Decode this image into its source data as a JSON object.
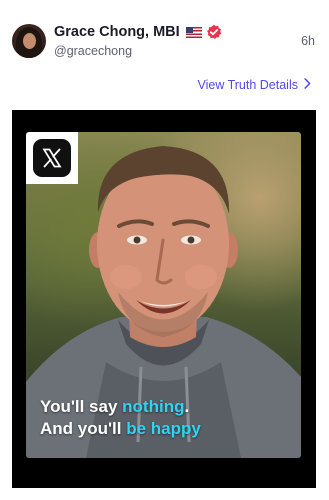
{
  "post": {
    "author": {
      "display_name": "Grace Chong, MBI",
      "handle": "@gracechong",
      "badges": [
        "us-flag-icon",
        "verified-icon"
      ],
      "verified_color": "#e8354a"
    },
    "timestamp": "6h",
    "details_link": "View Truth Details",
    "accent_color": "#5448ee",
    "media": {
      "badge_icon": "x-logo-icon",
      "caption_line1_a": "You'll say ",
      "caption_line1_b": "nothing",
      "caption_line1_c": ".",
      "caption_line2_a": "And you'll ",
      "caption_line2_b": "be happy",
      "highlight_color": "#2fd4f2"
    }
  }
}
